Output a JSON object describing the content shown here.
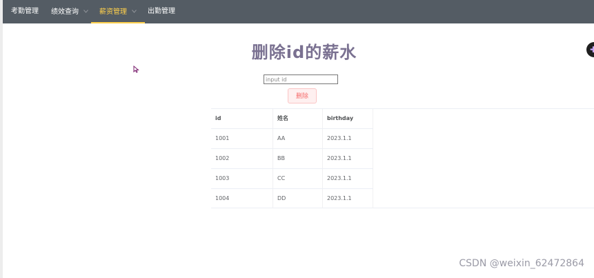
{
  "nav": {
    "items": [
      {
        "label": "考勤管理",
        "has_dropdown": false
      },
      {
        "label": "绩效查询",
        "has_dropdown": true
      },
      {
        "label": "薪资管理",
        "has_dropdown": true,
        "active": true
      },
      {
        "label": "出勤管理",
        "has_dropdown": false
      }
    ]
  },
  "page": {
    "title": "删除id的薪水"
  },
  "form": {
    "input_placeholder": "input id",
    "input_value": "",
    "delete_label": "删除"
  },
  "table": {
    "headers": [
      "id",
      "姓名",
      "birthday"
    ],
    "rows": [
      [
        "1001",
        "AA",
        "2023.1.1"
      ],
      [
        "1002",
        "BB",
        "2023.1.1"
      ],
      [
        "1003",
        "CC",
        "2023.1.1"
      ],
      [
        "1004",
        "DD",
        "2023.1.1"
      ]
    ]
  },
  "watermark": "CSDN @weixin_62472864",
  "colors": {
    "navbar_bg": "#545c64",
    "nav_active": "#ffd04b",
    "title": "#7a7191",
    "danger": "#f56c6c"
  }
}
